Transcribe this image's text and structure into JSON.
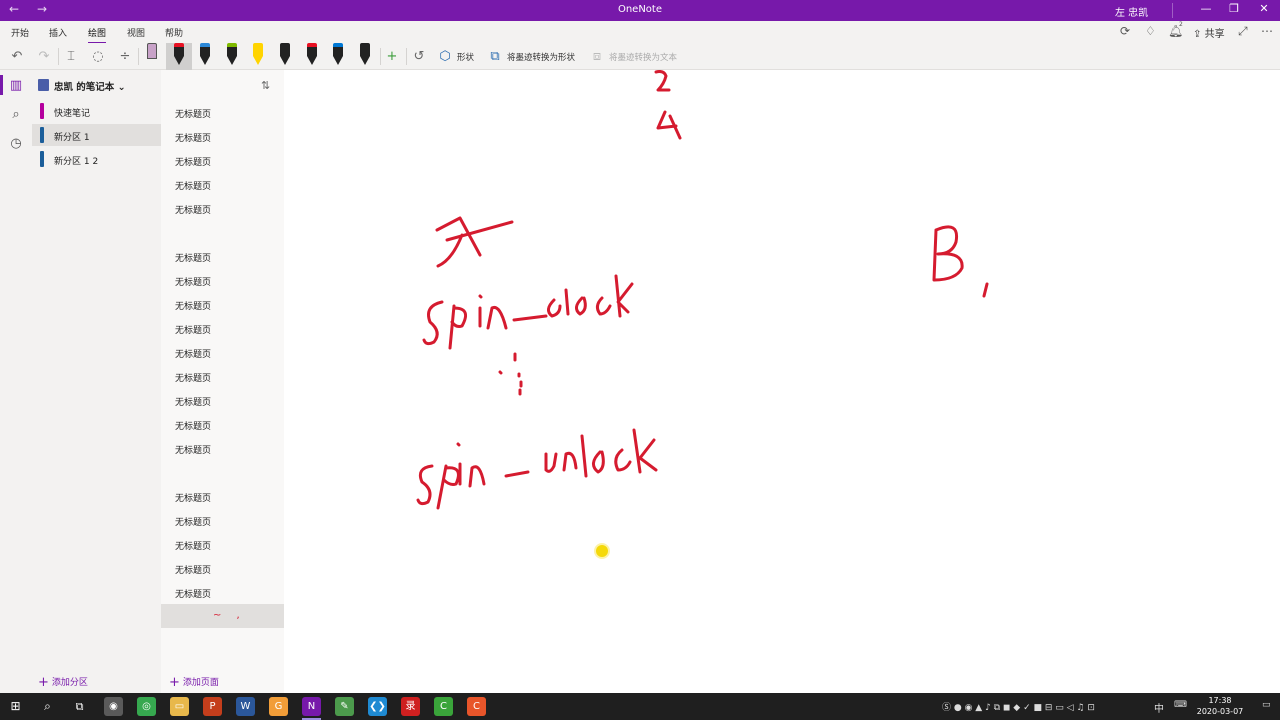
{
  "app": {
    "title": "OneNote",
    "user": "左 忠凯",
    "window_controls": [
      "—",
      "❐",
      "✕"
    ]
  },
  "menu": {
    "tabs": [
      "开始",
      "插入",
      "绘图",
      "视图",
      "帮助"
    ],
    "active_tab": "绘图",
    "share_label": "共享",
    "notification_count": "2"
  },
  "toolbar": {
    "shapes_label": "形状",
    "ink_to_shape_label": "将墨迹转换为形状",
    "ink_to_text_label": "将墨迹转换为文本",
    "pens": [
      {
        "color": "#c8a2c8",
        "kind": "eraser"
      },
      {
        "color": "#e81123",
        "kind": "pen",
        "selected": true
      },
      {
        "color": "#2b88d8",
        "kind": "pen"
      },
      {
        "color": "#7fba00",
        "kind": "pen"
      },
      {
        "color": "#ffd400",
        "kind": "highlighter"
      },
      {
        "color": "#222222",
        "kind": "pen"
      },
      {
        "color": "#e81123",
        "kind": "pen"
      },
      {
        "color": "#0078d4",
        "kind": "pen"
      },
      {
        "color": "#222222",
        "kind": "pen"
      }
    ]
  },
  "notebook": {
    "title": "忠凯 的笔记本",
    "sections": [
      {
        "label": "快速笔记",
        "color": "#b4009e"
      },
      {
        "label": "新分区 1",
        "color": "#1b5e9a",
        "selected": true
      },
      {
        "label": "新分区 1 2",
        "color": "#1b5e9a"
      }
    ],
    "add_section_label": "添加分区",
    "add_page_label": "添加页面"
  },
  "pages": {
    "items": [
      "无标题页",
      "无标题页",
      "无标题页",
      "无标题页",
      "无标题页",
      "",
      "无标题页",
      "无标题页",
      "无标题页",
      "无标题页",
      "无标题页",
      "无标题页",
      "无标题页",
      "无标题页",
      "无标题页",
      "",
      "无标题页",
      "无标题页",
      "无标题页",
      "无标题页",
      "无标题页"
    ],
    "selected_page_ink": "~ ,"
  },
  "canvas": {
    "ink_color": "#d51b2f",
    "handwriting": [
      "2",
      "4",
      "A",
      "spin - lock",
      "spin - unlock",
      "B ,"
    ]
  },
  "taskbar": {
    "apps": [
      {
        "name": "camera",
        "color": "#5a5a5a",
        "glyph": "◉"
      },
      {
        "name": "360",
        "color": "#36a84f",
        "glyph": "◎"
      },
      {
        "name": "explorer",
        "color": "#e8b84b",
        "glyph": "▭"
      },
      {
        "name": "powerpoint",
        "color": "#c43e1c",
        "glyph": "P"
      },
      {
        "name": "word",
        "color": "#2b579a",
        "glyph": "W"
      },
      {
        "name": "chrome-like",
        "color": "#f29d38",
        "glyph": "G"
      },
      {
        "name": "onenote",
        "color": "#7719aa",
        "glyph": "N",
        "active": true
      },
      {
        "name": "notepad",
        "color": "#4c9a4c",
        "glyph": "✎"
      },
      {
        "name": "vscode",
        "color": "#1f8ad2",
        "glyph": "❮❯"
      },
      {
        "name": "screen-recorder",
        "color": "#cf2020",
        "glyph": "录"
      },
      {
        "name": "camtasia-green",
        "color": "#3aa43a",
        "glyph": "C"
      },
      {
        "name": "camtasia-orange",
        "color": "#e8552a",
        "glyph": "C"
      }
    ],
    "ime": "中",
    "time": "17:38",
    "date": "2020-03-07"
  }
}
